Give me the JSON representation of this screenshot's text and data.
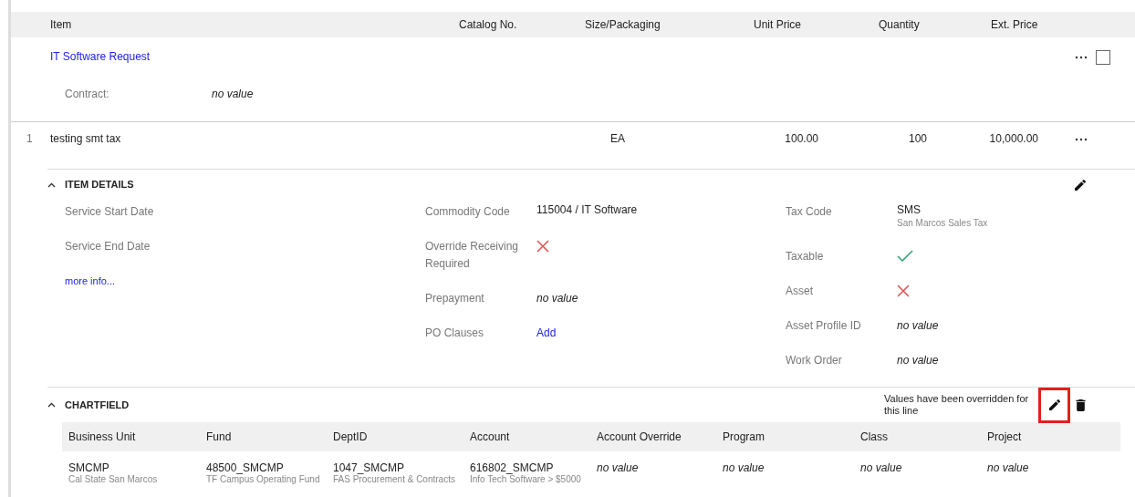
{
  "table": {
    "columns": [
      "Item",
      "Catalog No.",
      "Size/Packaging",
      "Unit Price",
      "Quantity",
      "Ext. Price"
    ]
  },
  "request": {
    "title": "IT Software Request",
    "contract_label": "Contract:",
    "contract_value": "no value",
    "checked": false
  },
  "line": {
    "number": "1",
    "item": "testing smt tax",
    "size": "EA",
    "unit_price": "100.00",
    "quantity": "100",
    "ext_price": "10,000.00"
  },
  "item_details": {
    "title": "ITEM DETAILS",
    "expanded": true,
    "more_link": "more info...",
    "columns": [
      [
        {
          "label": "Service Start Date",
          "kind": "blank"
        },
        {
          "label": "Service End Date",
          "kind": "blank"
        }
      ],
      [
        {
          "label": "Commodity Code",
          "kind": "text",
          "value": "115004 / IT Software"
        },
        {
          "label": "Override Receiving Required",
          "kind": "flag",
          "on": false
        },
        {
          "label": "Prepayment",
          "kind": "none",
          "value": "no value"
        },
        {
          "label": "PO Clauses",
          "kind": "link",
          "value": "Add"
        }
      ],
      [
        {
          "label": "Tax Code",
          "kind": "text",
          "value": "SMS",
          "sub": "San Marcos Sales Tax"
        },
        {
          "label": "Taxable",
          "kind": "flag",
          "on": true
        },
        {
          "label": "Asset",
          "kind": "flag",
          "on": false
        },
        {
          "label": "Asset Profile ID",
          "kind": "none",
          "value": "no value"
        },
        {
          "label": "Work Order",
          "kind": "none",
          "value": "no value"
        }
      ]
    ]
  },
  "chartfield": {
    "title": "CHARTFIELD",
    "expanded": true,
    "note": "Values have been overridden for this line",
    "edit_highlighted": true,
    "columns": [
      "Business Unit",
      "Fund",
      "DeptID",
      "Account",
      "Account Override",
      "Program",
      "Class",
      "Project"
    ],
    "rows": [
      [
        {
          "value": "SMCMP",
          "sub": "Cal State San Marcos"
        },
        {
          "value": "48500_SMCMP",
          "sub": "TF Campus Operating Fund"
        },
        {
          "value": "1047_SMCMP",
          "sub": "FAS Procurement & Contracts"
        },
        {
          "value": "616802_SMCMP",
          "sub": "Info Tech Software > $5000"
        },
        {
          "value": "no value",
          "kind": "none"
        },
        {
          "value": "no value",
          "kind": "none"
        },
        {
          "value": "no value",
          "kind": "none"
        },
        {
          "value": "no value",
          "kind": "none"
        }
      ]
    ]
  }
}
